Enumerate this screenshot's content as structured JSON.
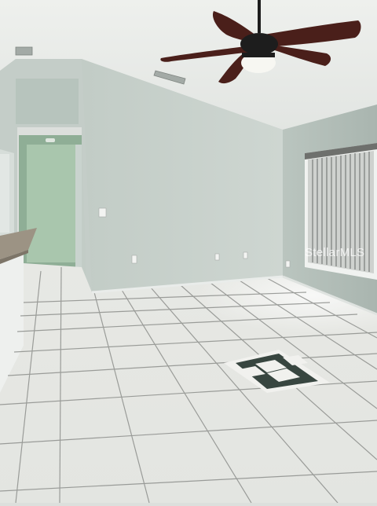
{
  "scene": {
    "room": "empty-living-room",
    "colors": {
      "ceiling": "#e9ebe8",
      "back_wall": "#c9d3cd",
      "right_wall": "#bdc8c3",
      "left_wall": "#c6cfca",
      "hallway": "#a9c6ad",
      "floor": "#e6e8e4",
      "grout": "#8d8f8c",
      "fan_blade": "#4a1f1a",
      "blinds": "#d5d7d4",
      "counter": "#9c9384"
    },
    "fixtures": [
      "ceiling-fan",
      "light-fixture",
      "air-vent",
      "window-blinds",
      "wall-outlet",
      "light-switch",
      "counter-top",
      "floor-medallion"
    ]
  },
  "watermark": {
    "text": "StellarMLS"
  }
}
